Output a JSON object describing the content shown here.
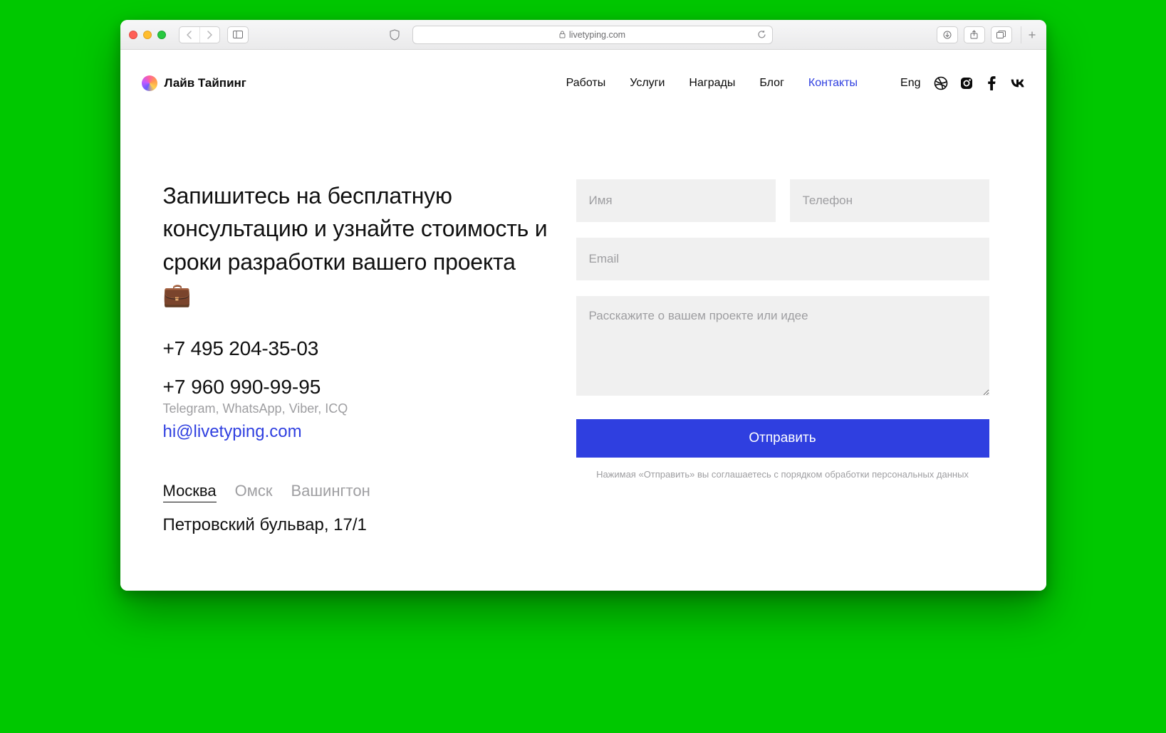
{
  "browser": {
    "url_display": "livetyping.com"
  },
  "header": {
    "logo_text": "Лайв Тайпинг",
    "nav": [
      {
        "label": "Работы",
        "active": false
      },
      {
        "label": "Услуги",
        "active": false
      },
      {
        "label": "Награды",
        "active": false
      },
      {
        "label": "Блог",
        "active": false
      },
      {
        "label": "Контакты",
        "active": true
      }
    ],
    "lang": "Eng"
  },
  "contact": {
    "heading": "Запишитесь на бесплатную консультацию и узнайте стоимость и сроки разработки вашего проекта 💼",
    "phone_primary": "+7 495 204-35-03",
    "phone_secondary": "+7 960 990-99-95",
    "messengers_note": "Telegram, WhatsApp, Viber, ICQ",
    "email": "hi@livetyping.com",
    "cities": [
      {
        "label": "Москва",
        "active": true
      },
      {
        "label": "Омск",
        "active": false
      },
      {
        "label": "Вашингтон",
        "active": false
      }
    ],
    "address": "Петровский бульвар, 17/1"
  },
  "form": {
    "name_placeholder": "Имя",
    "phone_placeholder": "Телефон",
    "email_placeholder": "Email",
    "message_placeholder": "Расскажите о вашем проекте или идее",
    "submit_label": "Отправить",
    "disclaimer": "Нажимая «Отправить» вы соглашаетесь с порядком обработки персональных данных"
  }
}
